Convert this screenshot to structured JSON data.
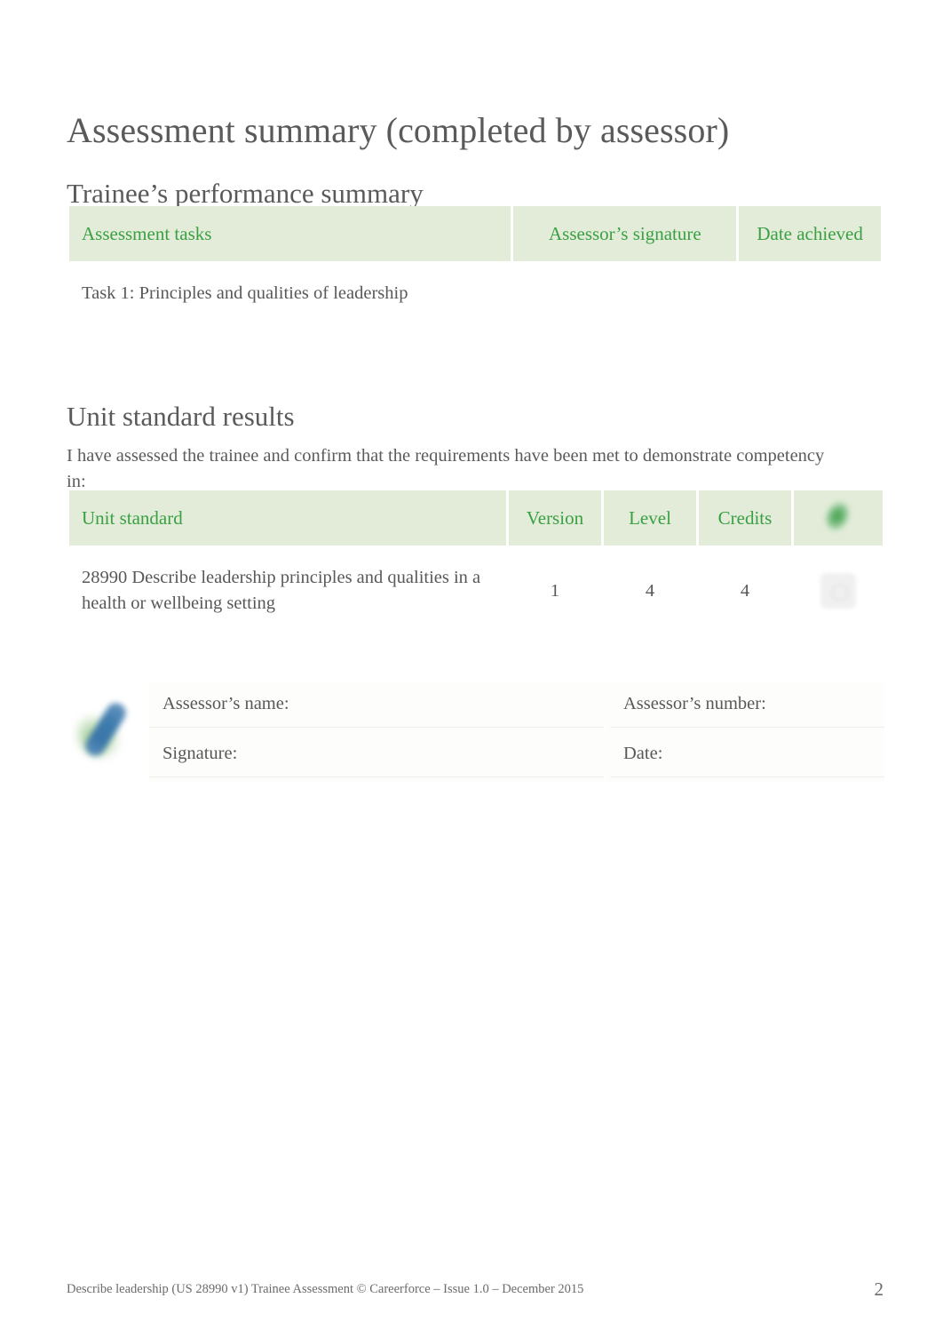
{
  "document": {
    "title": "Assessment summary (completed by assessor)",
    "sections": {
      "performance": {
        "heading": "Trainee’s performance summary"
      },
      "unit_results": {
        "heading": "Unit standard results",
        "intro": "I have assessed the trainee and confirm that the requirements have been met to demonstrate competency in:"
      }
    }
  },
  "table_performance": {
    "headers": [
      "Assessment tasks",
      "Assessor’s signature",
      "Date achieved"
    ],
    "rows": [
      {
        "task": "Task 1: Principles and qualities of leadership",
        "signature": "",
        "date_achieved": ""
      }
    ]
  },
  "table_unit": {
    "headers": [
      "Unit standard",
      "Version",
      "Level",
      "Credits",
      ""
    ],
    "header_icon": "green-check-mark-icon",
    "rows": [
      {
        "unit_standard": "28990 Describe leadership principles and qualities in a health or wellbeing setting",
        "version": "1",
        "level": "4",
        "credits": "4",
        "mark": ""
      }
    ]
  },
  "assessor_block": {
    "icon": "pen-tick-icon",
    "fields": {
      "name_label": "Assessor’s name:",
      "number_label": "Assessor’s number:",
      "signature_label": "Signature:",
      "date_label": "Date:",
      "name_value": "",
      "number_value": "",
      "signature_value": "",
      "date_value": ""
    }
  },
  "footer": {
    "text": "Describe leadership (US 28990 v1) Trainee Assessment © Careerforce – Issue 1.0 – December 2015",
    "page_number": "2"
  },
  "colors": {
    "header_background": "#e2ecd9",
    "header_text": "#3aa043",
    "body_text": "#585858",
    "heading_text": "#5a5a5a",
    "page_background": "#ffffff"
  }
}
